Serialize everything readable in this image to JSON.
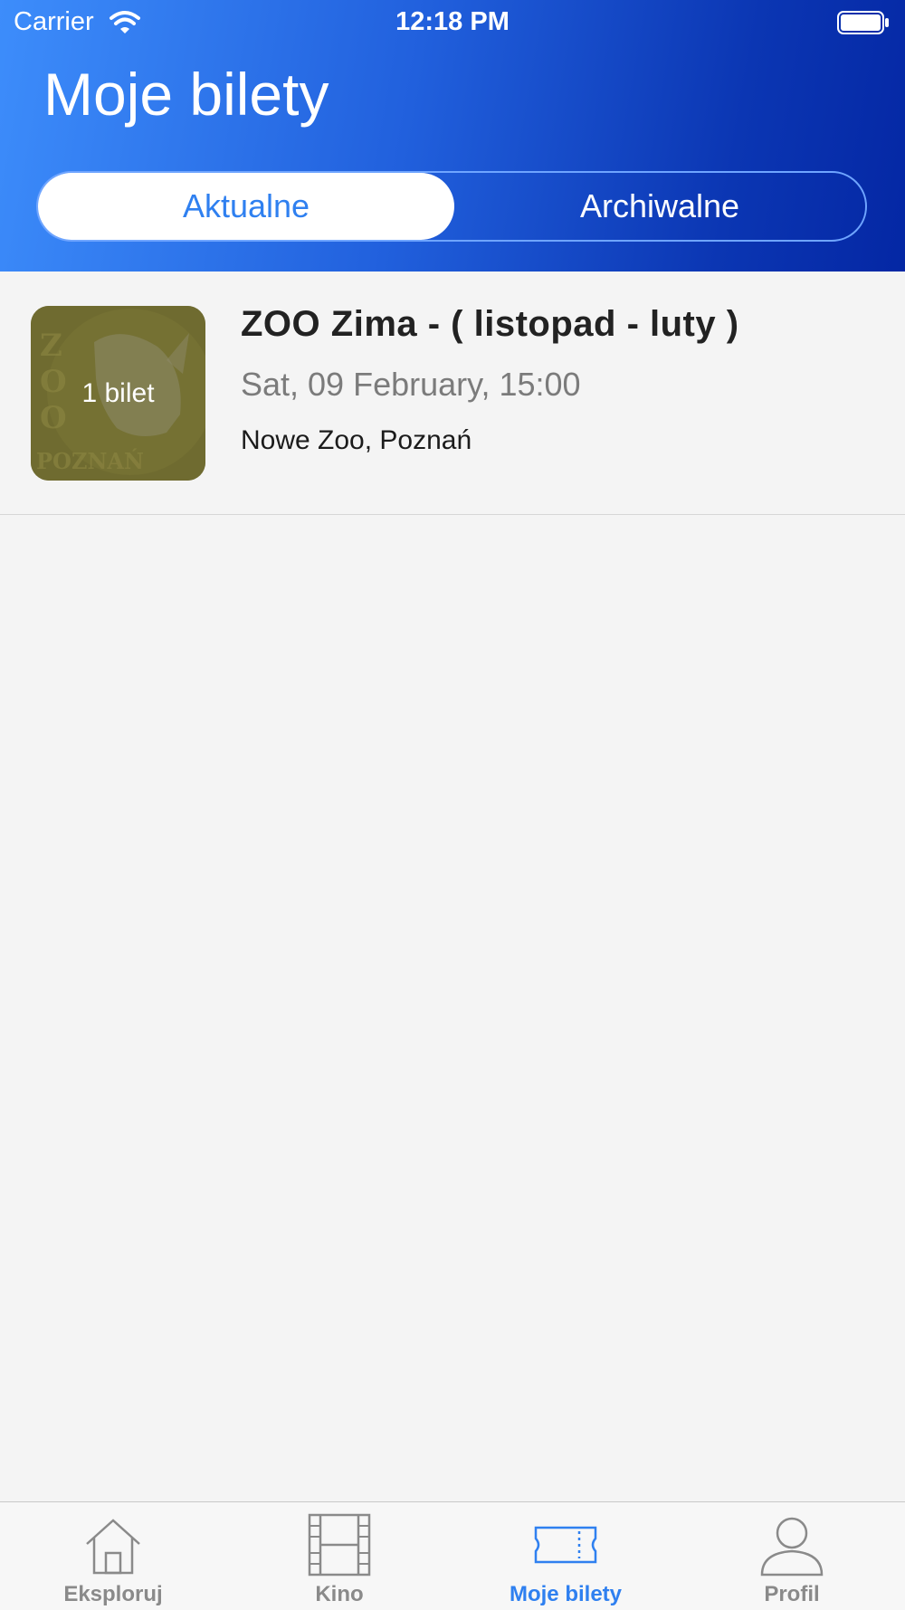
{
  "status_bar": {
    "carrier": "Carrier",
    "time": "12:18 PM"
  },
  "header": {
    "title": "Moje bilety"
  },
  "segments": {
    "active": "Aktualne",
    "inactive": "Archiwalne"
  },
  "tickets": [
    {
      "thumbnail_label": "1 bilet",
      "thumbnail_logo_text": "ZOO POZNAŃ",
      "title": "ZOO Zima - ( listopad - luty )",
      "datetime": "Sat, 09 February, 15:00",
      "venue": "Nowe Zoo, Poznań"
    }
  ],
  "tabbar": {
    "items": [
      {
        "label": "Eksploruj",
        "icon": "house-icon"
      },
      {
        "label": "Kino",
        "icon": "film-icon"
      },
      {
        "label": "Moje bilety",
        "icon": "ticket-icon",
        "active": true
      },
      {
        "label": "Profil",
        "icon": "person-icon"
      }
    ]
  },
  "colors": {
    "accent": "#2f80f0",
    "header_start": "#3d8dfb",
    "header_end": "#0427a4"
  }
}
